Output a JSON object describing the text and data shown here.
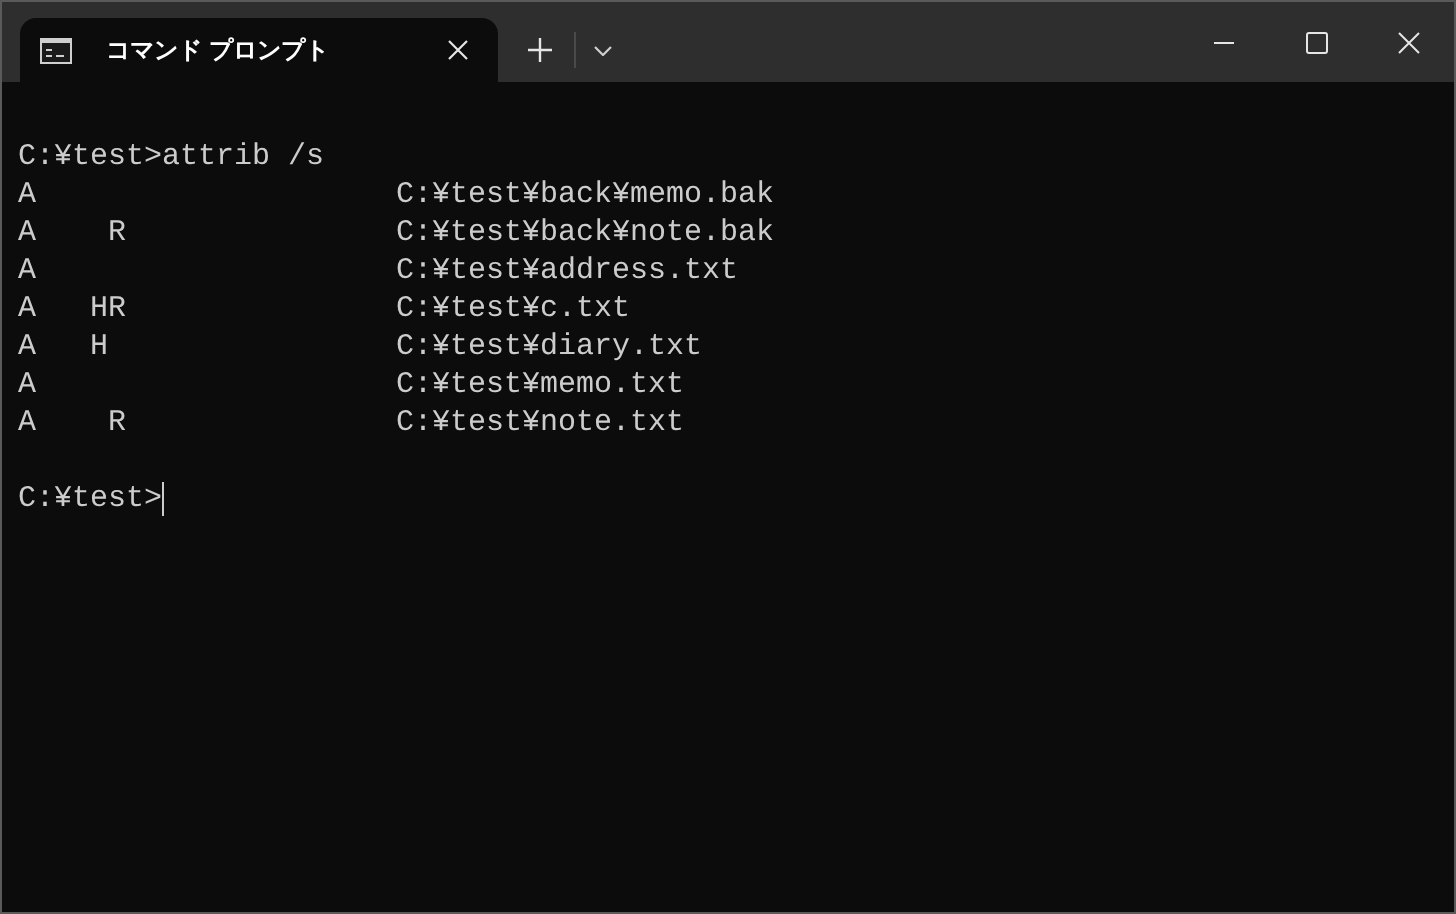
{
  "window": {
    "tabs": [
      {
        "title": "コマンド プロンプト",
        "selected": true
      }
    ]
  },
  "console": {
    "commands": [
      {
        "input": "C:¥test>attrib /s",
        "output": [
          "A                    C:¥test¥back¥memo.bak",
          "A    R               C:¥test¥back¥note.bak",
          "A                    C:¥test¥address.txt",
          "A   HR               C:¥test¥c.txt",
          "A   H                C:¥test¥diary.txt",
          "A                    C:¥test¥memo.txt",
          "A    R               C:¥test¥note.txt"
        ]
      }
    ],
    "prompt": "C:¥test>"
  }
}
